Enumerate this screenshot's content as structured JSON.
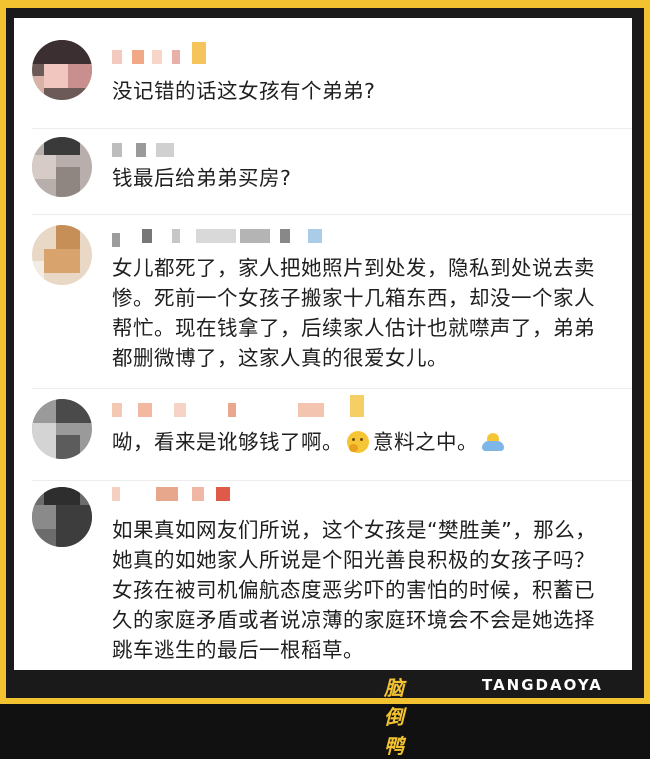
{
  "comments": [
    {
      "text": "没记错的话这女孩有个弟弟?"
    },
    {
      "text": "钱最后给弟弟买房?"
    },
    {
      "text": "女儿都死了，家人把她照片到处发，隐私到处说去卖惨。死前一个女孩子搬家十几箱东西，却没一个家人帮忙。现在钱拿了，后续家人估计也就噤声了，弟弟都删微博了，这家人真的很爱女儿。"
    },
    {
      "text_a": "呦，看来是讹够钱了啊。",
      "text_b": "意料之中。",
      "emoji_1": "thinking-face-emoji",
      "emoji_2": "shrug-emoji"
    },
    {
      "text": "如果真如网友们所说，这个女孩是“樊胜美”，那么，她真的如她家人所说是个阳光善良积极的女孩子吗？女孩在被司机偏航态度恶劣吓的害怕的时候，积蓄已久的家庭矛盾或者说凉薄的家庭环境会不会是她选择跳车逃生的最后一根稻草。"
    }
  ],
  "brand": {
    "cn": "脑倒鸭",
    "en": "TANGDAOYA"
  },
  "colors": {
    "frame": "#f2c230",
    "card": "#ffffff",
    "text": "#1f1f1f"
  }
}
